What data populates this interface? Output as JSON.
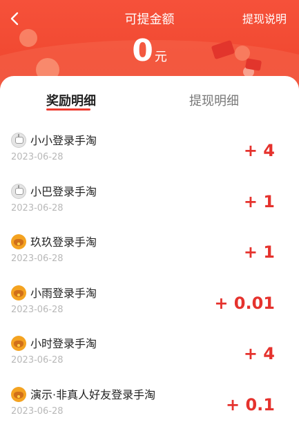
{
  "header": {
    "title": "可提金额",
    "help_link": "提现说明",
    "amount_value": "0",
    "amount_unit": "元"
  },
  "tabs": [
    {
      "label": "奖励明细",
      "active": true
    },
    {
      "label": "提现明细",
      "active": false
    }
  ],
  "colors": {
    "header_red": "#f14a32",
    "value_red": "#e5322d",
    "date_gray": "#b8b8b8"
  },
  "records": [
    {
      "avatar": "robot-icon",
      "name": "小小登录手淘",
      "date": "2023-06-28",
      "value": "+ 4"
    },
    {
      "avatar": "robot-icon",
      "name": "小巴登录手淘",
      "date": "2023-06-28",
      "value": "+ 1"
    },
    {
      "avatar": "chick-icon",
      "name": "玖玖登录手淘",
      "date": "2023-06-28",
      "value": "+ 1"
    },
    {
      "avatar": "chick-icon",
      "name": "小雨登录手淘",
      "date": "2023-06-28",
      "value": "+ 0.01"
    },
    {
      "avatar": "chick-icon",
      "name": "小时登录手淘",
      "date": "2023-06-28",
      "value": "+ 4"
    },
    {
      "avatar": "chick-icon",
      "name": "演示·非真人好友登录手淘",
      "date": "2023-06-28",
      "value": "+ 0.1"
    }
  ]
}
